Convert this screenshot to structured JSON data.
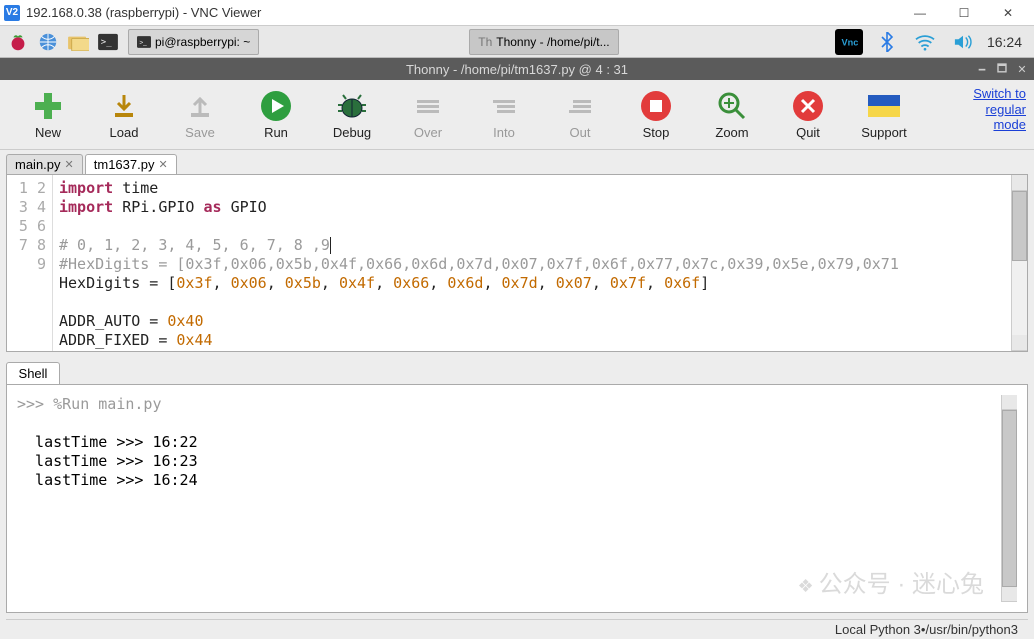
{
  "vnc": {
    "title": "192.168.0.38 (raspberrypi) - VNC Viewer"
  },
  "pi": {
    "task_terminal": "pi@raspberrypi: ~",
    "task_thonny": "Thonny  -  /home/pi/t...",
    "clock": "16:24"
  },
  "thonny": {
    "title": "Thonny  -  /home/pi/tm1637.py  @  4 : 31",
    "switch_link": "Switch to\nregular\nmode",
    "toolbar": {
      "new": "New",
      "load": "Load",
      "save": "Save",
      "run": "Run",
      "debug": "Debug",
      "over": "Over",
      "into": "Into",
      "out": "Out",
      "stop": "Stop",
      "zoom": "Zoom",
      "quit": "Quit",
      "support": "Support"
    },
    "tabs": {
      "main": "main.py",
      "tm1637": "tm1637.py"
    },
    "active_tab": "tm1637",
    "editor": {
      "lines": [
        1,
        2,
        3,
        4,
        5,
        6,
        7,
        8,
        9
      ],
      "tokens": {
        "l1_import": "import",
        "l1_time": " time",
        "l2_import": "import",
        "l2_rpi": " RPi.GPIO ",
        "l2_as": "as",
        "l2_gpio": " GPIO",
        "l4": "# 0, 1, 2, 3, 4, 5, 6, 7, 8 ,9",
        "l5": "#HexDigits = [0x3f,0x06,0x5b,0x4f,0x66,0x6d,0x7d,0x07,0x7f,0x6f,0x77,0x7c,0x39,0x5e,0x79,0x71",
        "l6_a": "HexDigits = [",
        "l6_h0": "0x3f",
        "l6_h1": "0x06",
        "l6_h2": "0x5b",
        "l6_h3": "0x4f",
        "l6_h4": "0x66",
        "l6_h5": "0x6d",
        "l6_h6": "0x7d",
        "l6_h7": "0x07",
        "l6_h8": "0x7f",
        "l6_h9": "0x6f",
        "l6_z": "]",
        "l8_a": "ADDR_AUTO = ",
        "l8_v": "0x40",
        "l9_a": "ADDR_FIXED = ",
        "l9_v": "0x44",
        "sep": ", "
      }
    },
    "shell": {
      "tab": "Shell",
      "prompt": ">>> ",
      "run_cmd": "%Run main.py",
      "out1": "  lastTime >>> 16:22",
      "out2": "  lastTime >>> 16:23",
      "out3": "  lastTime >>> 16:24"
    },
    "status": {
      "left": "Local Python 3 ",
      "mid": " • ",
      "right": " /usr/bin/python3"
    }
  },
  "watermark": "公众号 · 迷心兔"
}
